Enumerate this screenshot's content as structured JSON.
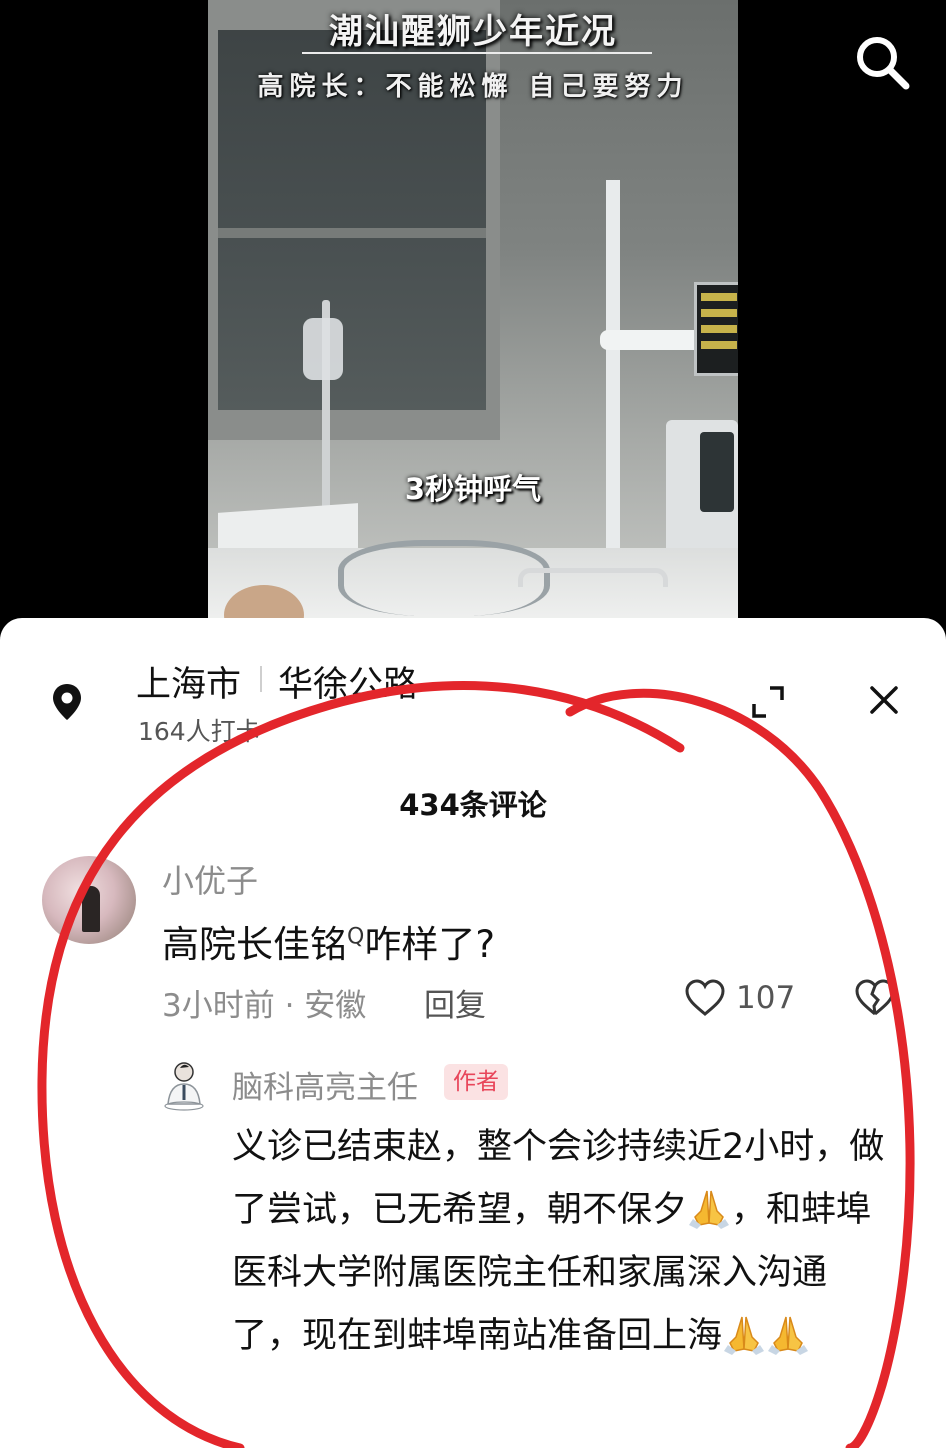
{
  "video": {
    "title": "潮汕醒狮少年近况",
    "subtitle": "高院长：不能松懈 自己要努力",
    "caption": "3秒钟呼气"
  },
  "icons": {
    "search": "search-icon",
    "location": "location-pin-icon",
    "expand": "expand-icon",
    "close": "close-icon",
    "like": "heart-icon",
    "dislike": "broken-heart-icon",
    "pray": "pray-emoji"
  },
  "location": {
    "city": "上海市",
    "road": "华徐公路",
    "checkins": "164人打卡"
  },
  "comments_header": "434条评论",
  "comment": {
    "author": "小优子",
    "text": "高院长佳铭",
    "search_mark": "Q",
    "text_tail": "咋样了?",
    "meta": "3小时前 · 安徽",
    "reply_label": "回复",
    "like_count": "107"
  },
  "reply": {
    "author": "脑科高亮主任",
    "badge": "作者",
    "text_part1": "义诊已结束赵，整个会诊持续近2小时，做了尝试，已无希望，朝不保夕",
    "text_part2": "，和蚌埠医科大学附属医院主任和家属深入沟通了，现在到蚌埠南站准备回上海"
  },
  "colors": {
    "annotation": "#e3262b",
    "badge_bg": "#fbe2e3",
    "badge_text": "#e8455a"
  }
}
